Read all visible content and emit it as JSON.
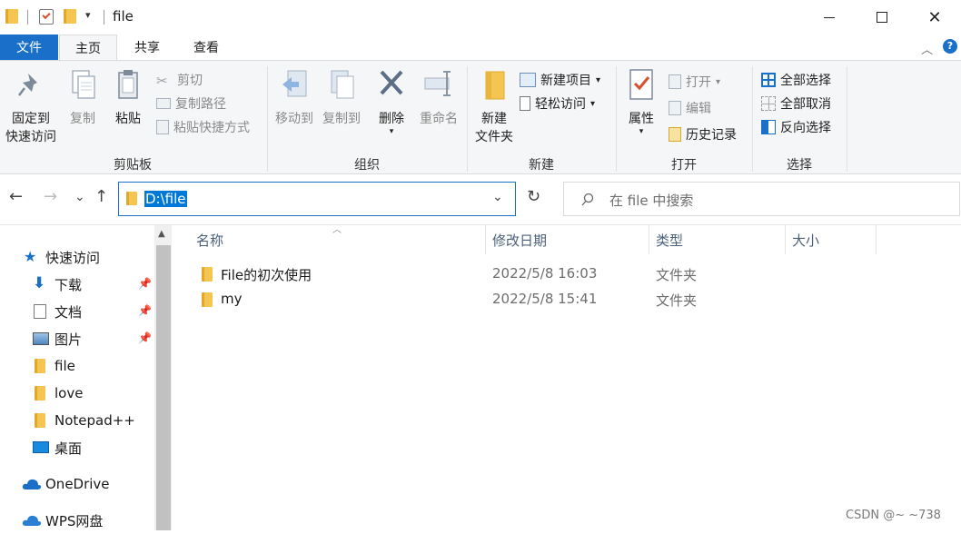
{
  "window": {
    "title": "file",
    "minimize": "—",
    "maximize": "☐",
    "close": "✕"
  },
  "tabs": {
    "file": "文件",
    "home": "主页",
    "share": "共享",
    "view": "查看"
  },
  "ribbon": {
    "clipboard": {
      "label": "剪贴板",
      "pin_line1": "固定到",
      "pin_line2": "快速访问",
      "copy": "复制",
      "paste": "粘贴",
      "cut": "剪切",
      "copy_path": "复制路径",
      "paste_shortcut": "粘贴快捷方式"
    },
    "organize": {
      "label": "组织",
      "move_to": "移动到",
      "copy_to": "复制到",
      "delete": "删除",
      "rename": "重命名"
    },
    "new": {
      "label": "新建",
      "new_folder_line1": "新建",
      "new_folder_line2": "文件夹",
      "new_item": "新建项目",
      "easy_access": "轻松访问"
    },
    "open": {
      "label": "打开",
      "properties": "属性",
      "open": "打开",
      "edit": "编辑",
      "history": "历史记录"
    },
    "select": {
      "label": "选择",
      "select_all": "全部选择",
      "select_none": "全部取消",
      "invert": "反向选择"
    }
  },
  "nav": {
    "back": "←",
    "forward": "→",
    "recent": "⌄",
    "up": "↑",
    "address": "D:\\file",
    "refresh": "↻",
    "search_placeholder": "在 file 中搜索"
  },
  "sidebar": {
    "items": [
      {
        "label": "快速访问",
        "icon": "star-icon"
      },
      {
        "label": "下载",
        "icon": "download-icon",
        "pinned": true
      },
      {
        "label": "文档",
        "icon": "document-icon",
        "pinned": true
      },
      {
        "label": "图片",
        "icon": "pictures-icon",
        "pinned": true
      },
      {
        "label": "file",
        "icon": "folder-icon"
      },
      {
        "label": "love",
        "icon": "folder-icon"
      },
      {
        "label": "Notepad++",
        "icon": "folder-icon"
      },
      {
        "label": "桌面",
        "icon": "desktop-icon"
      },
      {
        "label": "OneDrive",
        "icon": "cloud-icon"
      },
      {
        "label": "WPS网盘",
        "icon": "cloud-icon"
      }
    ]
  },
  "filelist": {
    "columns": [
      "名称",
      "修改日期",
      "类型",
      "大小"
    ],
    "rows": [
      {
        "name": "File的初次使用",
        "modified": "2022/5/8 16:03",
        "type": "文件夹",
        "size": ""
      },
      {
        "name": "my",
        "modified": "2022/5/8 15:41",
        "type": "文件夹",
        "size": ""
      }
    ]
  },
  "watermark": "CSDN @~ ~738",
  "colors": {
    "accent": "#1a6fc9",
    "folder": "#f4c550",
    "selection": "#0078d7"
  }
}
